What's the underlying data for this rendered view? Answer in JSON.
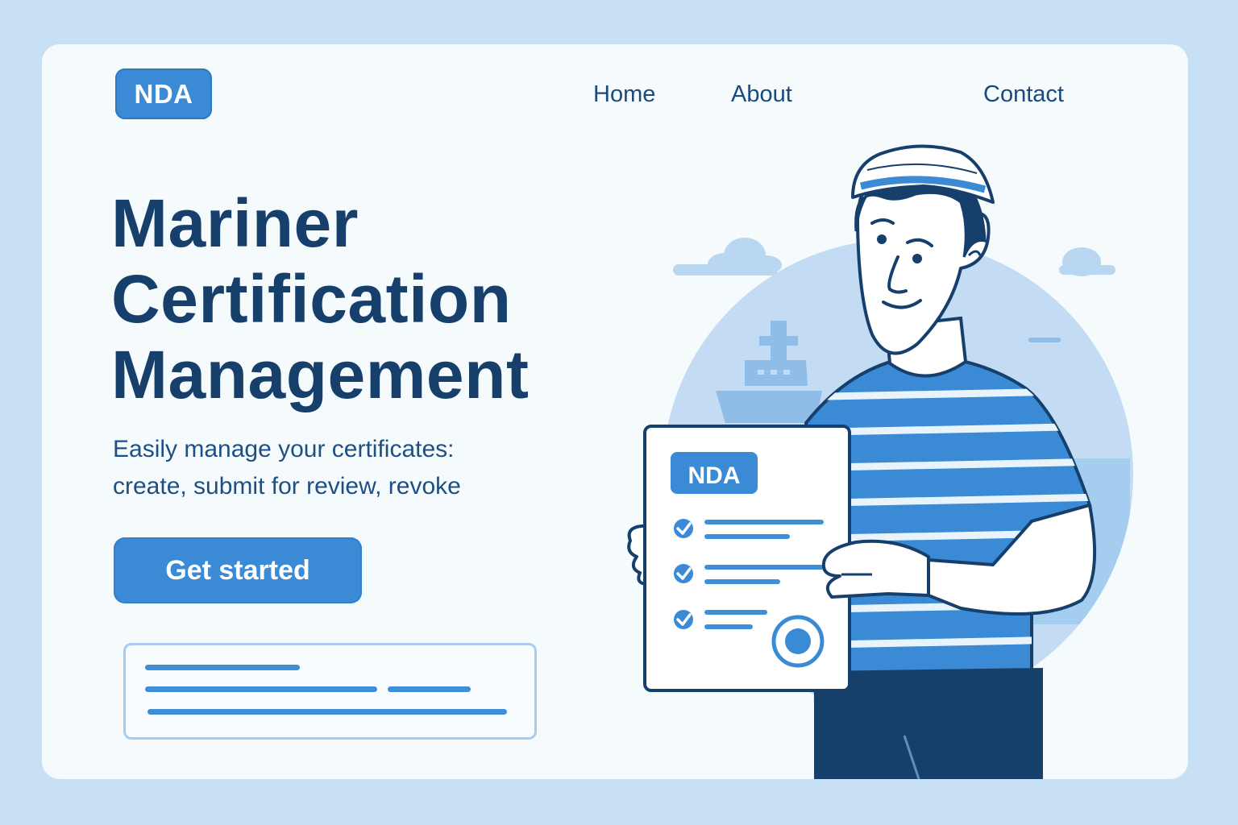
{
  "header": {
    "logo_text": "NDA",
    "nav": [
      {
        "label": "Home"
      },
      {
        "label": "About"
      },
      {
        "label": "Contact"
      }
    ]
  },
  "hero": {
    "title_lines": [
      "Mariner",
      "Certification",
      "Management"
    ],
    "subtitle_lines": [
      "Easily manage your certificates:",
      "create, submit for review, revoke"
    ],
    "cta_label": "Get started"
  },
  "illustration": {
    "document_badge": "NDA"
  },
  "colors": {
    "page_bg": "#c8e0f4",
    "card_bg": "#f5fbfd",
    "primary": "#3a8ad6",
    "title_navy": "#163f6c",
    "nav_text": "#1a4a7c"
  }
}
